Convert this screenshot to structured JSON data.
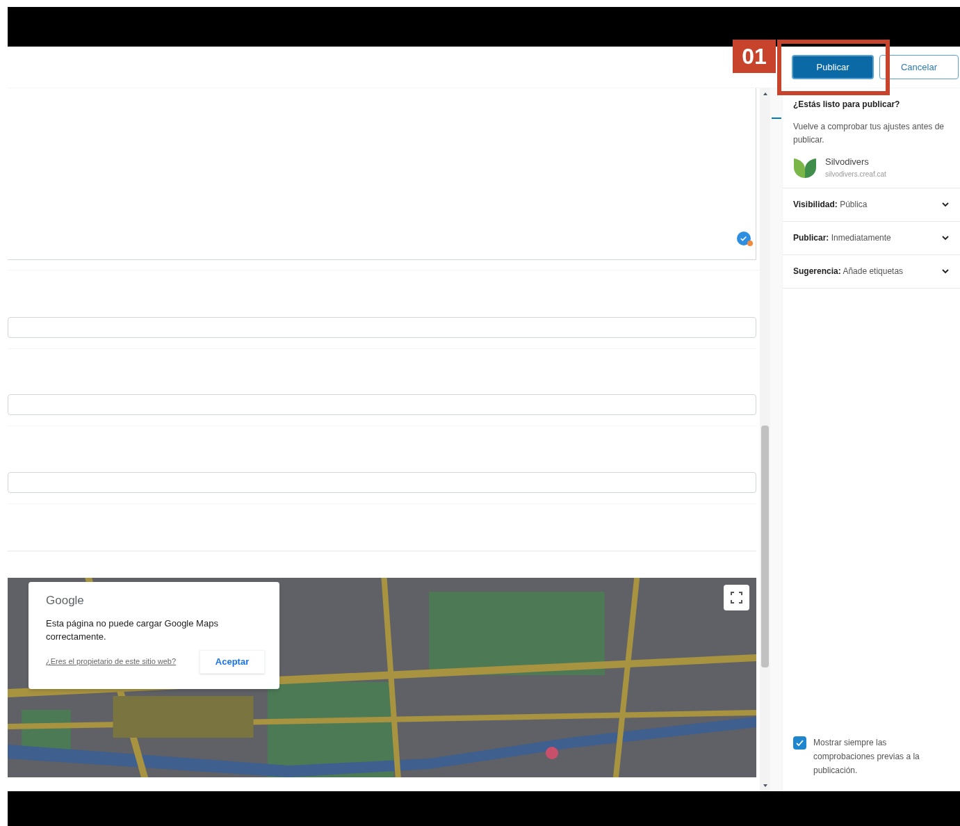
{
  "header": {
    "annotation": "01",
    "buttons": [
      {
        "label": "Publicar",
        "kind": "primary"
      },
      {
        "label": "Cancelar",
        "kind": "secondary"
      }
    ]
  },
  "editor": {
    "map": {
      "kind": "picture",
      "dialog": {
        "brand": "Google",
        "message": "Esta página no puede cargar Google Maps correctamente.",
        "link": "¿Eres el propietario de este sitio web?",
        "button": "Aceptar"
      }
    }
  },
  "prepublish": {
    "title": "¿Estás listo para publicar?",
    "description": "Vuelve a comprobar tus ajustes antes de publicar.",
    "site": {
      "name": "Silvodivers",
      "url": "silvodivers.creaf.cat"
    },
    "panels": [
      {
        "label": "Visibilidad:",
        "value": "Pública",
        "expanded": false
      },
      {
        "label": "Publicar:",
        "value": "Inmediatamente",
        "expanded": false
      },
      {
        "label": "Sugerencia:",
        "value": "Añade etiquetas",
        "expanded": false
      }
    ],
    "always_show": {
      "label": "Mostrar siempre las comprobaciones previas a la publicación.",
      "checked": true
    }
  }
}
